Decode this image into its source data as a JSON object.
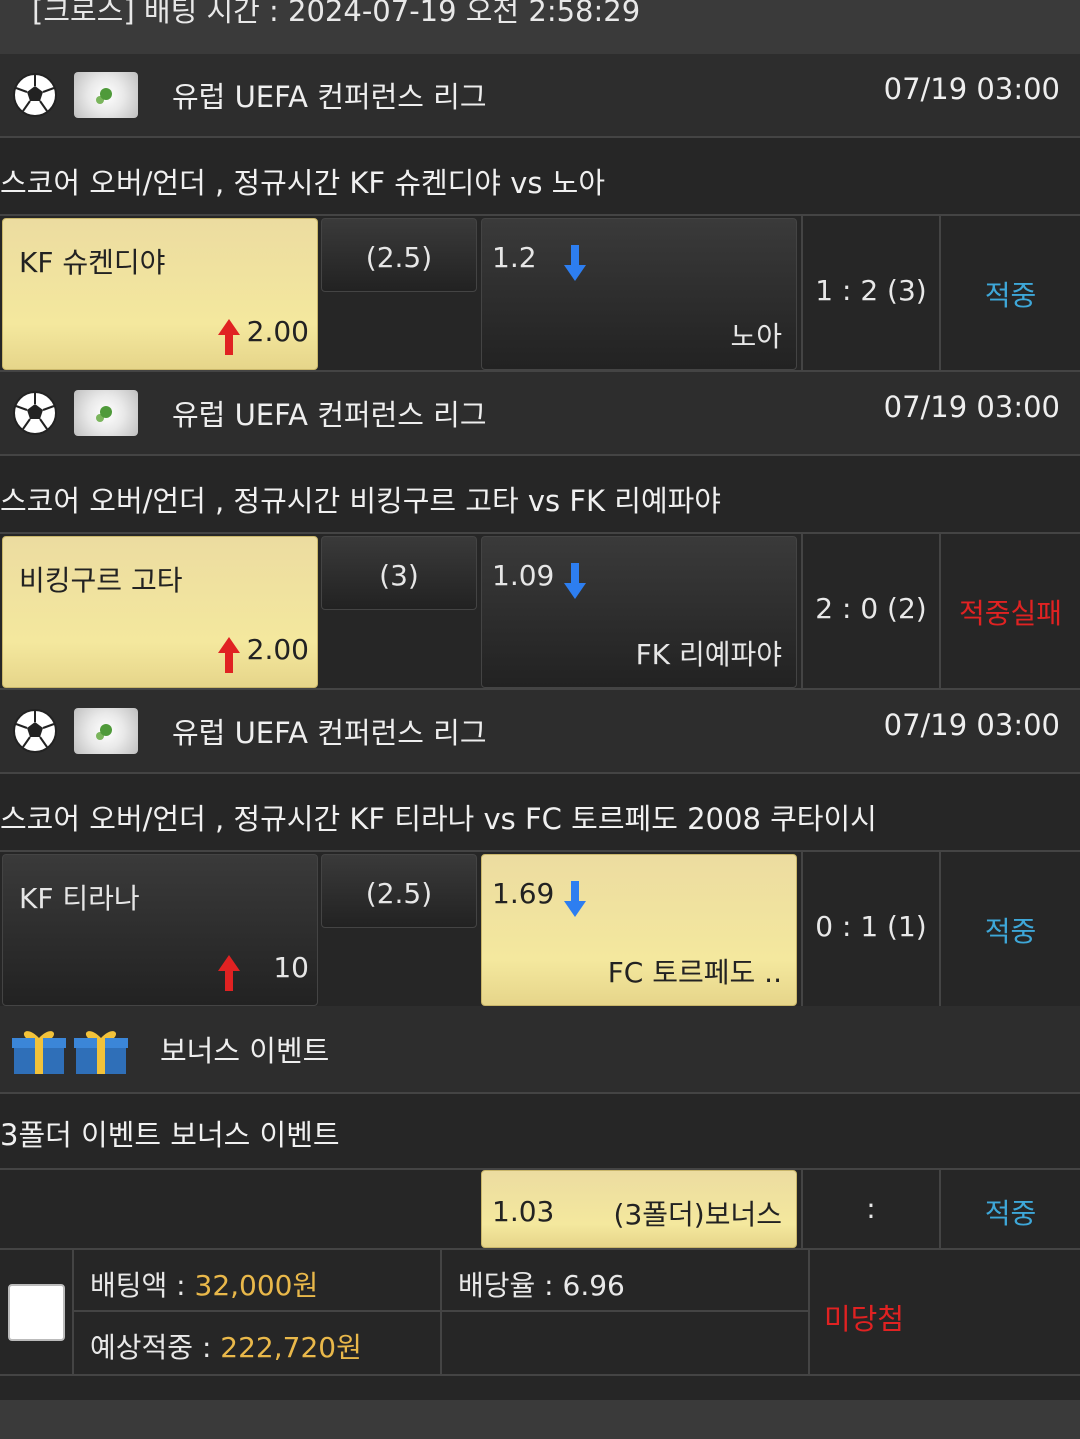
{
  "header": {
    "title": "[크로스] 배팅 시간 : 2024-07-19 오전 2:58:29"
  },
  "matches": [
    {
      "league": "유럽 UEFA 컨퍼런스 리그",
      "date": "07/19 03:00",
      "title": "스코어 오버/언더 , 정규시간 KF 슈켄디야  vs  노아",
      "home_team": "KF 슈켄디야",
      "home_odds": "2.00",
      "line": "(2.5)",
      "away_odds": "1.2",
      "away_team": "노아",
      "selected": "home",
      "score": "1 : 2 (3)",
      "result": "적중",
      "result_type": "hit"
    },
    {
      "league": "유럽 UEFA 컨퍼런스 리그",
      "date": "07/19 03:00",
      "title": "스코어 오버/언더 , 정규시간 비킹구르 고타  vs  FK 리예파야",
      "home_team": "비킹구르 고타",
      "home_odds": "2.00",
      "line": "(3)",
      "away_odds": "1.09",
      "away_team": "FK 리예파야",
      "selected": "home",
      "score": "2 : 0 (2)",
      "result": "적중실패",
      "result_type": "miss"
    },
    {
      "league": "유럽 UEFA 컨퍼런스 리그",
      "date": "07/19 03:00",
      "title": "스코어 오버/언더 , 정규시간 KF 티라나  vs  FC 토르페도 2008 쿠타이시",
      "home_team": "KF 티라나",
      "home_odds": "10",
      "line": "(2.5)",
      "away_odds": "1.69",
      "away_team": "FC 토르페도 ..",
      "selected": "away",
      "score": "0 : 1 (1)",
      "result": "적중",
      "result_type": "hit"
    }
  ],
  "bonus": {
    "header_label": "보너스 이벤트",
    "title": "3폴더 이벤트 보너스 이벤트",
    "odds": "1.03",
    "name": "(3폴더)보너스",
    "score": ":",
    "result": "적중"
  },
  "summary": {
    "bet_label": "배팅액 : ",
    "bet_amount": "32,000원",
    "rate_label": "배당율 : 6.96",
    "expected_label": "예상적중 : ",
    "expected_amount": "222,720원",
    "status": "미당첨"
  },
  "colors": {
    "hit": "#3ea7d8",
    "miss": "#e02222",
    "gold": "#f4e89e",
    "amount": "#e9b84a"
  },
  "icons": {
    "sport": "soccer-ball-icon",
    "flag": "uefa-globe-icon",
    "up": "arrow-up-icon",
    "down": "arrow-down-icon",
    "gift": "gift-box-icon"
  }
}
